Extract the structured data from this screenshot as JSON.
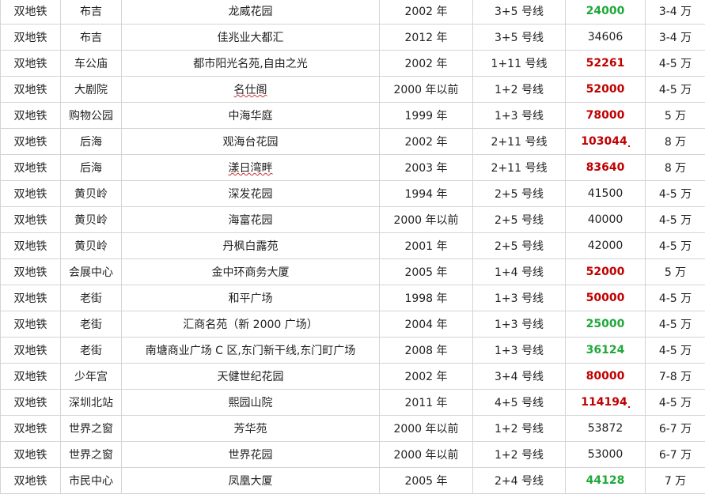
{
  "rows": [
    {
      "type": "双地铁",
      "area": "布吉",
      "estate": "龙威花园",
      "year": "2002 年",
      "lines": "3+5 号线",
      "price": "24000",
      "price_color": "green",
      "total": "3-4 万"
    },
    {
      "type": "双地铁",
      "area": "布吉",
      "estate": "佳兆业大都汇",
      "year": "2012 年",
      "lines": "3+5 号线",
      "price": "34606",
      "price_color": "black",
      "total": "3-4 万"
    },
    {
      "type": "双地铁",
      "area": "车公庙",
      "estate": "都市阳光名苑,自由之光",
      "year": "2002 年",
      "lines": "1+11 号线",
      "price": "52261",
      "price_color": "red",
      "total": "4-5 万"
    },
    {
      "type": "双地铁",
      "area": "大剧院",
      "estate": "名仕阁",
      "year": "2000 年以前",
      "lines": "1+2 号线",
      "price": "52000",
      "price_color": "red",
      "total": "4-5 万"
    },
    {
      "type": "双地铁",
      "area": "购物公园",
      "estate": "中海华庭",
      "year": "1999 年",
      "lines": "1+3 号线",
      "price": "78000",
      "price_color": "red",
      "total": "5 万"
    },
    {
      "type": "双地铁",
      "area": "后海",
      "estate": "观海台花园",
      "year": "2002 年",
      "lines": "2+11 号线",
      "price": "103044",
      "price_color": "red",
      "total": "8 万"
    },
    {
      "type": "双地铁",
      "area": "后海",
      "estate": "漾日湾畔",
      "year": "2003 年",
      "lines": "2+11 号线",
      "price": "83640",
      "price_color": "red",
      "total": "8 万"
    },
    {
      "type": "双地铁",
      "area": "黄贝岭",
      "estate": "深发花园",
      "year": "1994 年",
      "lines": "2+5 号线",
      "price": "41500",
      "price_color": "black",
      "total": "4-5 万"
    },
    {
      "type": "双地铁",
      "area": "黄贝岭",
      "estate": "海富花园",
      "year": "2000 年以前",
      "lines": "2+5 号线",
      "price": "40000",
      "price_color": "black",
      "total": "4-5 万"
    },
    {
      "type": "双地铁",
      "area": "黄贝岭",
      "estate": "丹枫白露苑",
      "year": "2001 年",
      "lines": "2+5 号线",
      "price": "42000",
      "price_color": "black",
      "total": "4-5 万"
    },
    {
      "type": "双地铁",
      "area": "会展中心",
      "estate": "金中环商务大厦",
      "year": "2005 年",
      "lines": "1+4 号线",
      "price": "52000",
      "price_color": "red",
      "total": "5 万"
    },
    {
      "type": "双地铁",
      "area": "老街",
      "estate": "和平广场",
      "year": "1998 年",
      "lines": "1+3 号线",
      "price": "50000",
      "price_color": "red",
      "total": "4-5 万"
    },
    {
      "type": "双地铁",
      "area": "老街",
      "estate": "汇商名苑（新 2000 广场）",
      "year": "2004 年",
      "lines": "1+3 号线",
      "price": "25000",
      "price_color": "green",
      "total": "4-5 万"
    },
    {
      "type": "双地铁",
      "area": "老街",
      "estate": "南塘商业广场 C 区,东门新干线,东门町广场",
      "year": "2008 年",
      "lines": "1+3 号线",
      "price": "36124",
      "price_color": "green",
      "total": "4-5 万"
    },
    {
      "type": "双地铁",
      "area": "少年宫",
      "estate": "天健世纪花园",
      "year": "2002 年",
      "lines": "3+4 号线",
      "price": "80000",
      "price_color": "red",
      "total": "7-8 万"
    },
    {
      "type": "双地铁",
      "area": "深圳北站",
      "estate": "熙园山院",
      "year": "2011 年",
      "lines": "4+5 号线",
      "price": "114194",
      "price_color": "red",
      "total": "4-5 万"
    },
    {
      "type": "双地铁",
      "area": "世界之窗",
      "estate": "芳华苑",
      "year": "2000 年以前",
      "lines": "1+2 号线",
      "price": "53872",
      "price_color": "black",
      "total": "6-7 万"
    },
    {
      "type": "双地铁",
      "area": "世界之窗",
      "estate": "世界花园",
      "year": "2000 年以前",
      "lines": "1+2 号线",
      "price": "53000",
      "price_color": "black",
      "total": "6-7 万"
    },
    {
      "type": "双地铁",
      "area": "市民中心",
      "estate": "凤凰大厦",
      "year": "2005 年",
      "lines": "2+4 号线",
      "price": "44128",
      "price_color": "green",
      "total": "7 万"
    }
  ]
}
